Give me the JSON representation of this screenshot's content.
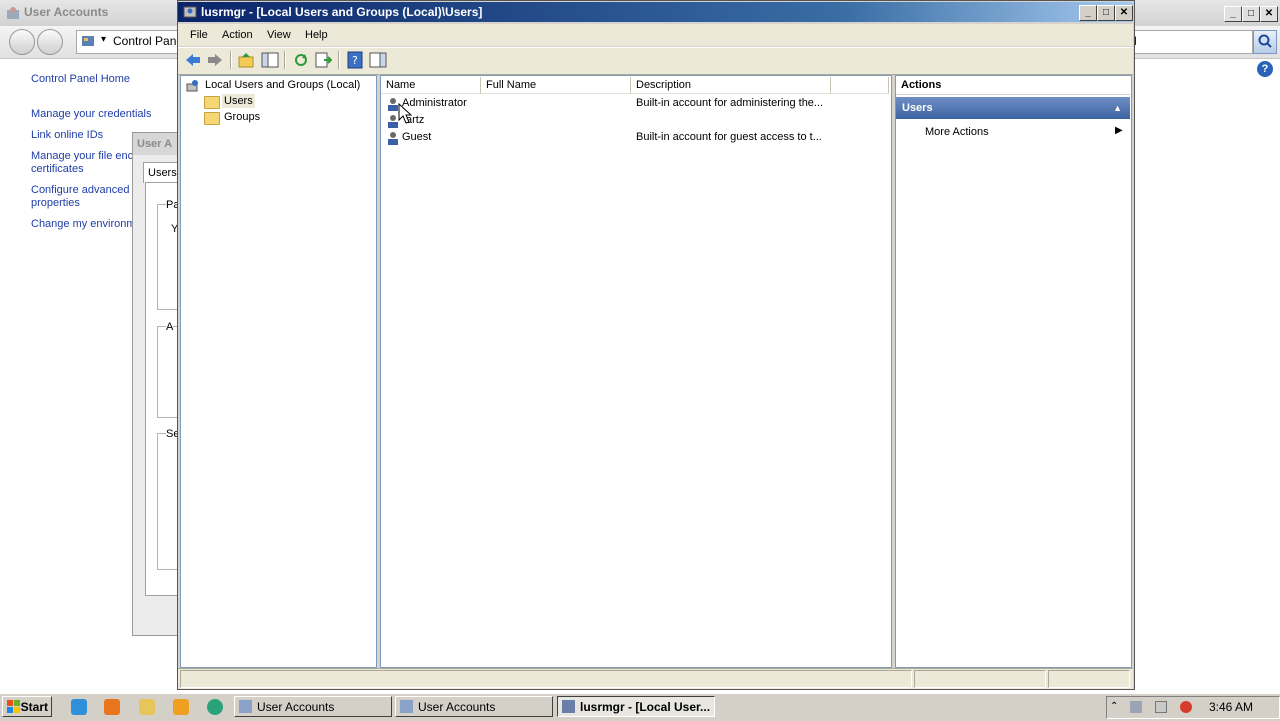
{
  "background_window": {
    "title": "User Accounts",
    "address": "Control Panel",
    "search_fragment": "l",
    "links": [
      "Control Panel Home",
      "Manage your credentials",
      "Link online IDs",
      "Manage your file enc",
      "certificates",
      "Configure advanced",
      "properties",
      "Change my environm"
    ],
    "dialog": {
      "title": "User A",
      "tab": "Users",
      "group1": "Pa",
      "group1_text": "Y",
      "group2": "A",
      "group3": "Se"
    }
  },
  "window": {
    "title": "lusrmgr - [Local Users and Groups (Local)\\Users]",
    "menu": [
      "File",
      "Action",
      "View",
      "Help"
    ]
  },
  "tree": {
    "root": "Local Users and Groups (Local)",
    "children": [
      "Users",
      "Groups"
    ]
  },
  "list": {
    "columns": [
      "Name",
      "Full Name",
      "Description"
    ],
    "rows": [
      {
        "name": "Administrator",
        "full_name": "",
        "description": "Built-in account for administering the..."
      },
      {
        "name": "artz",
        "full_name": "",
        "description": ""
      },
      {
        "name": "Guest",
        "full_name": "",
        "description": "Built-in account for guest access to t..."
      }
    ]
  },
  "actions": {
    "header": "Actions",
    "section": "Users",
    "items": [
      "More Actions"
    ]
  },
  "taskbar": {
    "start": "Start",
    "tasks": [
      "User Accounts",
      "User Accounts",
      "lusrmgr - [Local User..."
    ],
    "clock": "3:46 AM"
  },
  "colors": {
    "title_active": "#0a246a",
    "actions_section": "#3e63a4",
    "link": "#1e3da8"
  }
}
